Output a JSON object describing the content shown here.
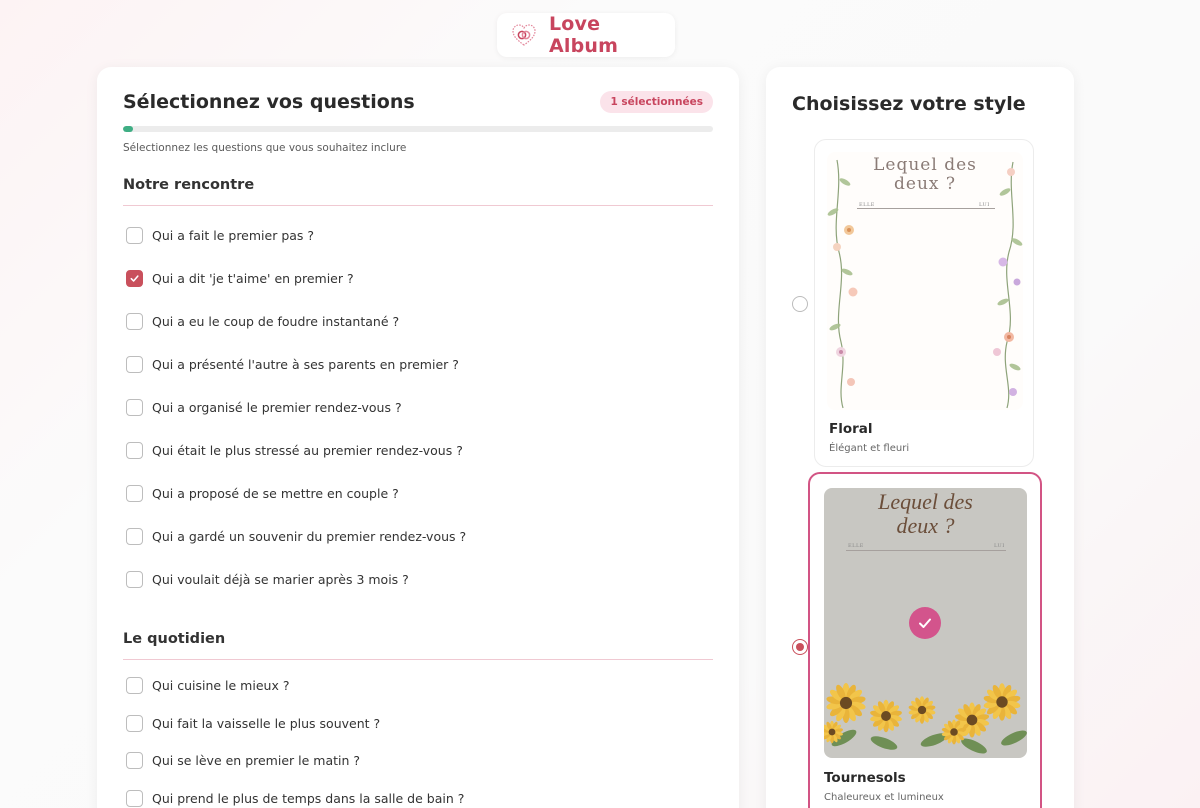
{
  "header": {
    "logo_text": "Love Album",
    "logo_icon": "heart-rings-icon"
  },
  "questions_panel": {
    "title": "Sélectionnez vos questions",
    "badge": "1 sélectionnées",
    "progress": 0.017,
    "subtitle": "Sélectionnez les questions que vous souhaitez inclure",
    "sections": [
      {
        "title": "Notre rencontre",
        "questions": [
          {
            "text": "Qui a fait le premier pas ?",
            "checked": false
          },
          {
            "text": "Qui a dit 'je t'aime' en premier ?",
            "checked": true
          },
          {
            "text": "Qui a eu le coup de foudre instantané ?",
            "checked": false
          },
          {
            "text": "Qui a présenté l'autre à ses parents en premier ?",
            "checked": false
          },
          {
            "text": "Qui a organisé le premier rendez-vous ?",
            "checked": false
          },
          {
            "text": "Qui était le plus stressé au premier rendez-vous ?",
            "checked": false
          },
          {
            "text": "Qui a proposé de se mettre en couple ?",
            "checked": false
          },
          {
            "text": "Qui a gardé un souvenir du premier rendez-vous ?",
            "checked": false
          },
          {
            "text": "Qui voulait déjà se marier après 3 mois ?",
            "checked": false
          }
        ]
      },
      {
        "title": "Le quotidien",
        "questions": [
          {
            "text": "Qui cuisine le mieux ?",
            "checked": false
          },
          {
            "text": "Qui fait la vaisselle le plus souvent ?",
            "checked": false
          },
          {
            "text": "Qui se lève en premier le matin ?",
            "checked": false
          },
          {
            "text": "Qui prend le plus de temps dans la salle de bain ?",
            "checked": false
          }
        ]
      }
    ]
  },
  "style_panel": {
    "title": "Choisissez votre style",
    "styles": [
      {
        "name": "Floral",
        "description": "Élégant et fleuri",
        "selected": false,
        "preview_title_line1": "Lequel des",
        "preview_title_line2": "deux ?",
        "preview_left": "ELLE",
        "preview_right": "LUI"
      },
      {
        "name": "Tournesols",
        "description": "Chaleureux et lumineux",
        "selected": true,
        "preview_title_line1": "Lequel des",
        "preview_title_line2": "deux ?",
        "preview_left": "ELLE",
        "preview_right": "LUI"
      }
    ]
  },
  "colors": {
    "accent": "#c8455e",
    "checkbox_checked": "#c9505c",
    "selected_border": "#d25484",
    "progress": "#3fae84",
    "sunflower_bg": "#c8c7c2"
  }
}
